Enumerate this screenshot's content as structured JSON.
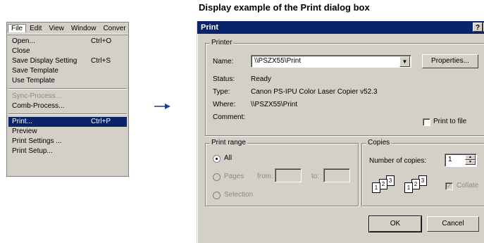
{
  "caption": "Display example of the Print dialog box",
  "menu": {
    "bar": [
      "File",
      "Edit",
      "View",
      "Window",
      "Conver"
    ],
    "items": {
      "open": {
        "label": "Open...",
        "shortcut": "Ctrl+O"
      },
      "close": {
        "label": "Close"
      },
      "save_display": {
        "label": "Save Display Setting",
        "shortcut": "Ctrl+S"
      },
      "save_template": {
        "label": "Save Template"
      },
      "use_template": {
        "label": "Use Template"
      },
      "sync_process": {
        "label": "Sync-Process..."
      },
      "comb_process": {
        "label": "Comb-Process..."
      },
      "print": {
        "label": "Print...",
        "shortcut": "Ctrl+P"
      },
      "preview": {
        "label": "Preview"
      },
      "print_settings": {
        "label": "Print Settings ..."
      },
      "print_setup": {
        "label": "Print Setup..."
      }
    }
  },
  "arrow_icon": "right-arrow",
  "dialog": {
    "title": "Print",
    "help_btn": "?",
    "close_btn": "x",
    "printer": {
      "group": "Printer",
      "name_label": "Name:",
      "name_value": "\\\\PSZX55\\Print",
      "properties": "Properties...",
      "status_label": "Status:",
      "status_value": "Ready",
      "type_label": "Type:",
      "type_value": "Canon PS-IPU Color Laser Copier v52.3",
      "where_label": "Where:",
      "where_value": "\\\\PSZX55\\Print",
      "comment_label": "Comment:",
      "print_to_file": "Print to file"
    },
    "range": {
      "group": "Print range",
      "all": "All",
      "pages": "Pages",
      "from": "from:",
      "to": "to:",
      "selection": "Selection"
    },
    "copies": {
      "group": "Copies",
      "number_label": "Number of copies:",
      "number_value": "1",
      "collate": "Collate",
      "page_numbers": [
        "1",
        "2",
        "3"
      ]
    },
    "ok": "OK",
    "cancel": "Cancel"
  },
  "colors": {
    "selection": "#0a246a",
    "face": "#d4d0c8",
    "arrow": "#1f3f8f"
  }
}
